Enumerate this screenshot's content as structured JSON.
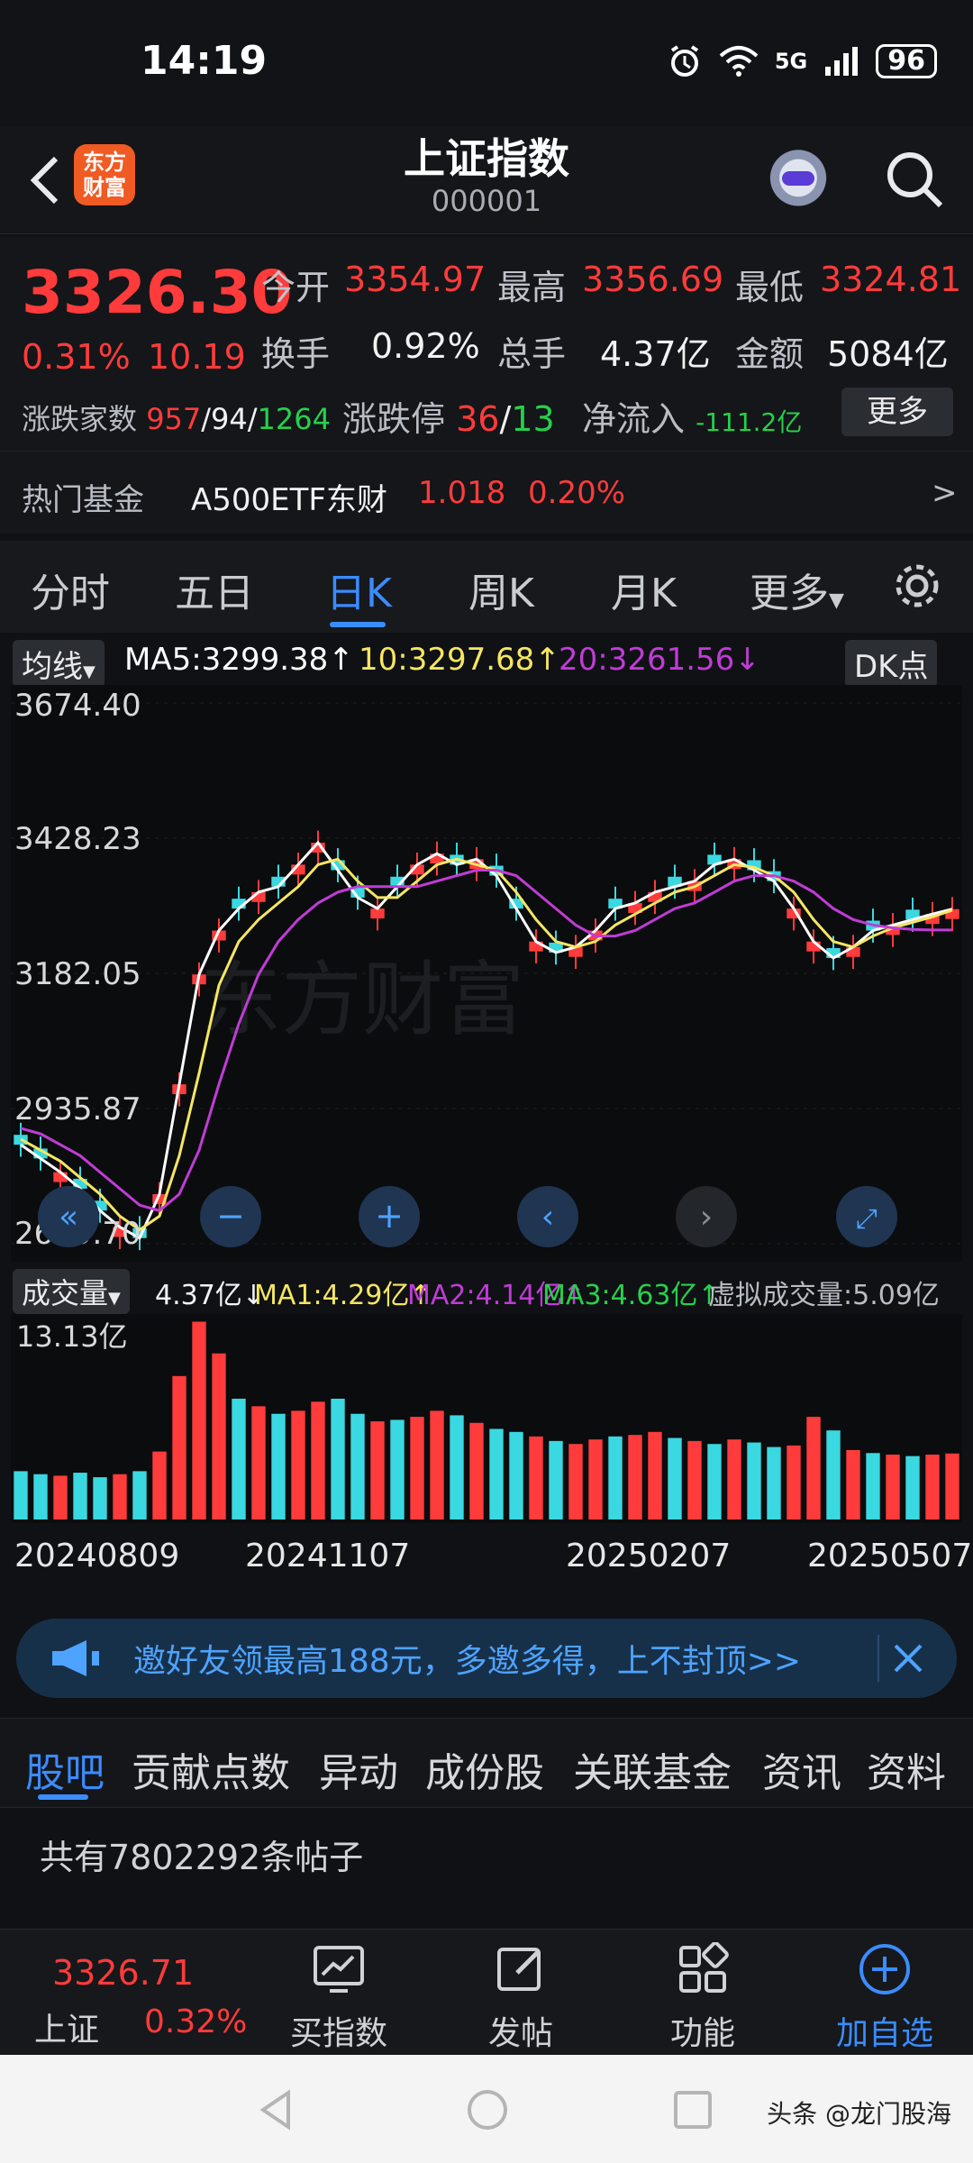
{
  "status_bar": {
    "time": "14:19",
    "network": "5G",
    "battery": "96"
  },
  "header": {
    "logo_text": "东方财富",
    "title": "上证指数",
    "code": "000001"
  },
  "quote": {
    "price": "3326.30",
    "change_pct": "0.31%",
    "change": "10.19",
    "open_label": "今开",
    "open": "3354.97",
    "high_label": "最高",
    "high": "3356.69",
    "low_label": "最低",
    "low": "3324.81",
    "turnover_label": "换手",
    "turnover": "0.92%",
    "volume_label": "总手",
    "volume": "4.37亿",
    "amount_label": "金额",
    "amount": "5084亿",
    "breadth_label": "涨跌家数",
    "up_count": "957",
    "flat_count": "94",
    "down_count": "1264",
    "limit_label": "涨跌停",
    "limit_up": "36",
    "limit_down": "13",
    "netflow_label": "净流入",
    "netflow": "-111.2亿",
    "more_button": "更多"
  },
  "hot_fund": {
    "label": "热门基金",
    "name": "A500ETF东财",
    "price": "1.018",
    "change": "0.20%",
    "arrow": ">"
  },
  "tabs": [
    "分时",
    "五日",
    "日K",
    "周K",
    "月K",
    "更多"
  ],
  "ma_row": {
    "mode": "均线",
    "ma5": "MA5:3299.38↑",
    "ma10": "10:3297.68↑",
    "ma20": "20:3261.56↓",
    "dk_button": "DK点"
  },
  "volume_row": {
    "mode": "成交量",
    "vol": "4.37亿↓",
    "ma1": "MA1:4.29亿↑",
    "ma2": "MA2:4.14亿↑",
    "ma3": "MA3:4.63亿↑",
    "virtual": "虚拟成交量:5.09亿"
  },
  "colors": {
    "up": "#ff3b3b",
    "down": "#3ad8e0",
    "ma5": "#ffffff",
    "ma10": "#f5e663",
    "ma20": "#c03cd6",
    "accent": "#3b8cff"
  },
  "chart_data": {
    "type": "line",
    "title": "",
    "y_ticks": [
      "3674.40",
      "3428.23",
      "3182.05",
      "2935.87",
      "2689.70"
    ],
    "ylim": [
      2689.7,
      3674.4
    ],
    "x_ticks": [
      "20240809",
      "20241107",
      "20250207",
      "20250507"
    ],
    "watermark": "东方财富",
    "series": [
      {
        "name": "MA5",
        "color": "#ffffff",
        "values": [
          2870,
          2845,
          2820,
          2790,
          2750,
          2720,
          2700,
          2780,
          2980,
          3180,
          3260,
          3300,
          3330,
          3340,
          3380,
          3420,
          3370,
          3320,
          3300,
          3340,
          3380,
          3400,
          3380,
          3390,
          3360,
          3300,
          3240,
          3220,
          3230,
          3260,
          3300,
          3310,
          3330,
          3340,
          3350,
          3380,
          3390,
          3370,
          3350,
          3300,
          3240,
          3210,
          3230,
          3260,
          3270,
          3280,
          3290,
          3299
        ]
      },
      {
        "name": "MA10",
        "color": "#f5e663",
        "values": [
          2880,
          2860,
          2840,
          2810,
          2780,
          2740,
          2715,
          2740,
          2850,
          3000,
          3160,
          3240,
          3280,
          3310,
          3340,
          3380,
          3390,
          3350,
          3320,
          3320,
          3350,
          3380,
          3390,
          3380,
          3370,
          3330,
          3280,
          3240,
          3230,
          3240,
          3270,
          3290,
          3310,
          3330,
          3340,
          3360,
          3380,
          3375,
          3360,
          3330,
          3280,
          3240,
          3230,
          3250,
          3265,
          3275,
          3285,
          3297
        ]
      },
      {
        "name": "MA20",
        "color": "#c03cd6",
        "values": [
          2900,
          2890,
          2870,
          2850,
          2820,
          2790,
          2760,
          2750,
          2780,
          2860,
          2980,
          3090,
          3180,
          3240,
          3280,
          3310,
          3330,
          3340,
          3340,
          3340,
          3340,
          3350,
          3360,
          3370,
          3370,
          3360,
          3330,
          3300,
          3270,
          3250,
          3250,
          3260,
          3280,
          3300,
          3310,
          3330,
          3350,
          3360,
          3360,
          3350,
          3330,
          3300,
          3280,
          3270,
          3265,
          3262,
          3261,
          3261
        ]
      }
    ],
    "volume": {
      "y_tick": "13.13亿",
      "ylim": [
        0,
        13.13
      ],
      "values": [
        3.2,
        3.0,
        2.9,
        3.1,
        2.8,
        3.0,
        3.2,
        4.5,
        9.5,
        13.1,
        11.0,
        8.0,
        7.5,
        7.0,
        7.2,
        7.8,
        8.0,
        7.0,
        6.5,
        6.6,
        6.8,
        7.2,
        6.9,
        6.4,
        6.0,
        5.8,
        5.5,
        5.2,
        5.0,
        5.3,
        5.5,
        5.6,
        5.8,
        5.4,
        5.2,
        5.0,
        5.3,
        5.1,
        4.8,
        4.9,
        6.8,
        5.9,
        4.6,
        4.4,
        4.3,
        4.2,
        4.3,
        4.37
      ],
      "up_flags": [
        0,
        0,
        1,
        0,
        0,
        1,
        0,
        1,
        1,
        1,
        1,
        0,
        1,
        0,
        1,
        1,
        0,
        0,
        1,
        0,
        1,
        1,
        0,
        1,
        0,
        0,
        1,
        0,
        1,
        1,
        0,
        1,
        1,
        0,
        1,
        0,
        1,
        0,
        0,
        1,
        1,
        0,
        1,
        0,
        1,
        0,
        1,
        1
      ]
    }
  },
  "banner": {
    "text": "邀好友领最高188元，多邀多得，上不封顶>>"
  },
  "sub_tabs": [
    "股吧",
    "贡献点数",
    "异动",
    "成份股",
    "关联基金",
    "资讯",
    "资料"
  ],
  "posts": {
    "text": "共有7802292条帖子"
  },
  "bottom_nav": {
    "index_price": "3326.71",
    "index_name": "上证",
    "index_change": "0.32%",
    "items": [
      "买指数",
      "发帖",
      "功能",
      "加自选"
    ]
  },
  "system_bar": {
    "watermark": "头条 @龙门股海"
  }
}
